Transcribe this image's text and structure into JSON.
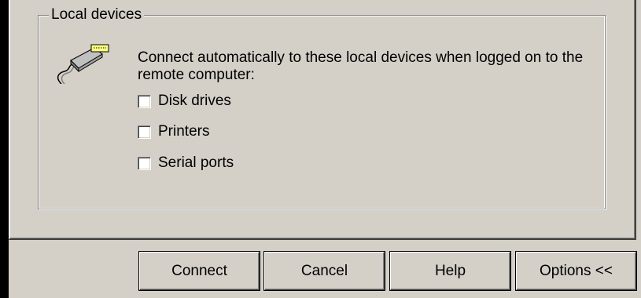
{
  "groupbox": {
    "title": "Local devices",
    "description": "Connect automatically to these local devices when logged on to the remote computer:",
    "icon": "usb-cable-icon"
  },
  "options": [
    {
      "label": "Disk drives",
      "checked": false
    },
    {
      "label": "Printers",
      "checked": false
    },
    {
      "label": "Serial ports",
      "checked": false
    }
  ],
  "buttons": {
    "connect": "Connect",
    "cancel": "Cancel",
    "help": "Help",
    "options": "Options <<"
  },
  "colors": {
    "face": "#d4d0c8",
    "shadow": "#808080",
    "highlight": "#ffffff",
    "plug_yellow": "#ffff80"
  }
}
